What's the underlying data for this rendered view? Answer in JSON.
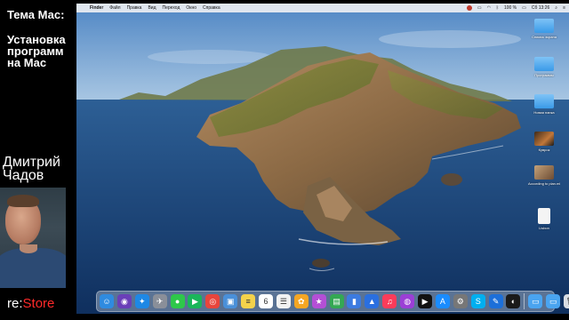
{
  "presenter": {
    "topic_title": "Тема Мас:",
    "topic_name": "Установка программ на Мас",
    "name": "Дмитрий Чадов",
    "brand_prefix": "re:",
    "brand_suffix": "Store"
  },
  "menubar": {
    "app": "Finder",
    "items": [
      "Файл",
      "Правка",
      "Вид",
      "Переход",
      "Окно",
      "Справка"
    ],
    "battery": "100 %",
    "clock": "Сб 13:26"
  },
  "desktop_icons": [
    {
      "label": "Снимок экрана",
      "kind": "folder"
    },
    {
      "label": "Программы",
      "kind": "folder"
    },
    {
      "label": "Новая папка",
      "kind": "folder"
    },
    {
      "label": "Куврок",
      "kind": "photo"
    },
    {
      "label": "According to plan.mkv",
      "kind": "photo2"
    },
    {
      "label": "Lisbon",
      "kind": "doc"
    }
  ],
  "dock": {
    "apps": [
      {
        "name": "finder-icon",
        "color": "#2f8be0",
        "glyph": "☺"
      },
      {
        "name": "siri-icon",
        "color": "#6a3fb8",
        "glyph": "◉"
      },
      {
        "name": "safari-icon",
        "color": "#1e88e5",
        "glyph": "✦"
      },
      {
        "name": "launchpad-icon",
        "color": "#8a8f99",
        "glyph": "✈"
      },
      {
        "name": "messages-icon",
        "color": "#2ec84a",
        "glyph": "●"
      },
      {
        "name": "facetime-icon",
        "color": "#1ab65a",
        "glyph": "▶"
      },
      {
        "name": "chrome-icon",
        "color": "#e8453c",
        "glyph": "◎"
      },
      {
        "name": "preview-icon",
        "color": "#4a90d9",
        "glyph": "▣"
      },
      {
        "name": "notes-icon",
        "color": "#f4d24b",
        "glyph": "≡"
      },
      {
        "name": "calendar-icon",
        "color": "#ffffff",
        "glyph": "6"
      },
      {
        "name": "reminders-icon",
        "color": "#f2f2f2",
        "glyph": "☰"
      },
      {
        "name": "photos-icon",
        "color": "#f5a623",
        "glyph": "✿"
      },
      {
        "name": "itunes-star-icon",
        "color": "#b44fd6",
        "glyph": "★"
      },
      {
        "name": "numbers-icon",
        "color": "#34a853",
        "glyph": "▤"
      },
      {
        "name": "charts-icon",
        "color": "#3c7be0",
        "glyph": "▮"
      },
      {
        "name": "keynote-icon",
        "color": "#2a6fe0",
        "glyph": "▲"
      },
      {
        "name": "music-icon",
        "color": "#fa3c5a",
        "glyph": "♫"
      },
      {
        "name": "podcasts-icon",
        "color": "#9b3fd6",
        "glyph": "◍"
      },
      {
        "name": "apple-tv-icon",
        "color": "#111111",
        "glyph": "▶"
      },
      {
        "name": "app-store-icon",
        "color": "#1a8cff",
        "glyph": "A"
      },
      {
        "name": "system-prefs-icon",
        "color": "#777777",
        "glyph": "⚙"
      },
      {
        "name": "skype-icon",
        "color": "#00aff0",
        "glyph": "S"
      },
      {
        "name": "xcode-icon",
        "color": "#1c6fd9",
        "glyph": "✎"
      },
      {
        "name": "github-icon",
        "color": "#1a1a1a",
        "glyph": "◐"
      }
    ],
    "right": [
      {
        "name": "downloads-folder-icon",
        "color": "#4aa4f0",
        "glyph": "▭"
      },
      {
        "name": "documents-folder-icon",
        "color": "#4aa4f0",
        "glyph": "▭"
      },
      {
        "name": "trash-icon",
        "color": "#d9dde3",
        "glyph": "🗑"
      }
    ]
  }
}
